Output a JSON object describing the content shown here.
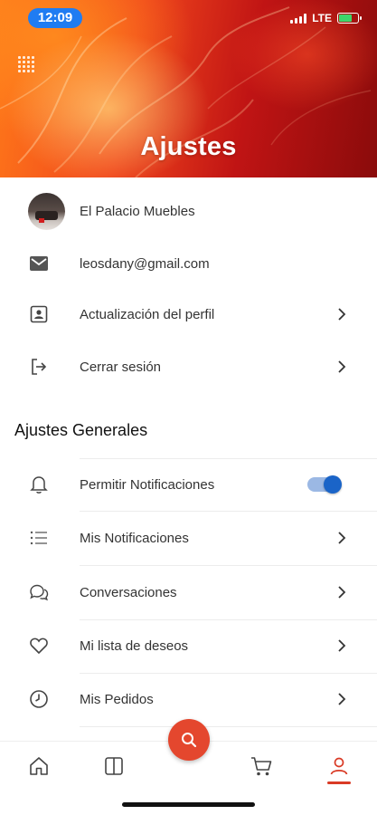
{
  "status_bar": {
    "time": "12:09",
    "network": "LTE"
  },
  "header": {
    "title": "Ajustes"
  },
  "profile": {
    "name": "El Palacio Muebles",
    "email": "leosdany@gmail.com",
    "update_profile": "Actualización del perfil",
    "logout": "Cerrar sesión"
  },
  "general": {
    "title": "Ajustes Generales",
    "items": [
      {
        "label": "Permitir Notificaciones",
        "icon": "bell-icon",
        "toggle": true
      },
      {
        "label": "Mis Notificaciones",
        "icon": "list-icon"
      },
      {
        "label": "Conversaciones",
        "icon": "chat-icon"
      },
      {
        "label": "Mi lista de deseos",
        "icon": "heart-icon"
      },
      {
        "label": "Mis Pedidos",
        "icon": "clock-icon"
      }
    ]
  },
  "bottom_nav": {
    "items": [
      "home-icon",
      "catalog-icon",
      "search-icon",
      "cart-icon",
      "profile-icon"
    ],
    "active": "profile-icon"
  },
  "colors": {
    "accent": "#e4472e",
    "toggle": "#1a64c8",
    "status_pill": "#1f7cf2"
  }
}
